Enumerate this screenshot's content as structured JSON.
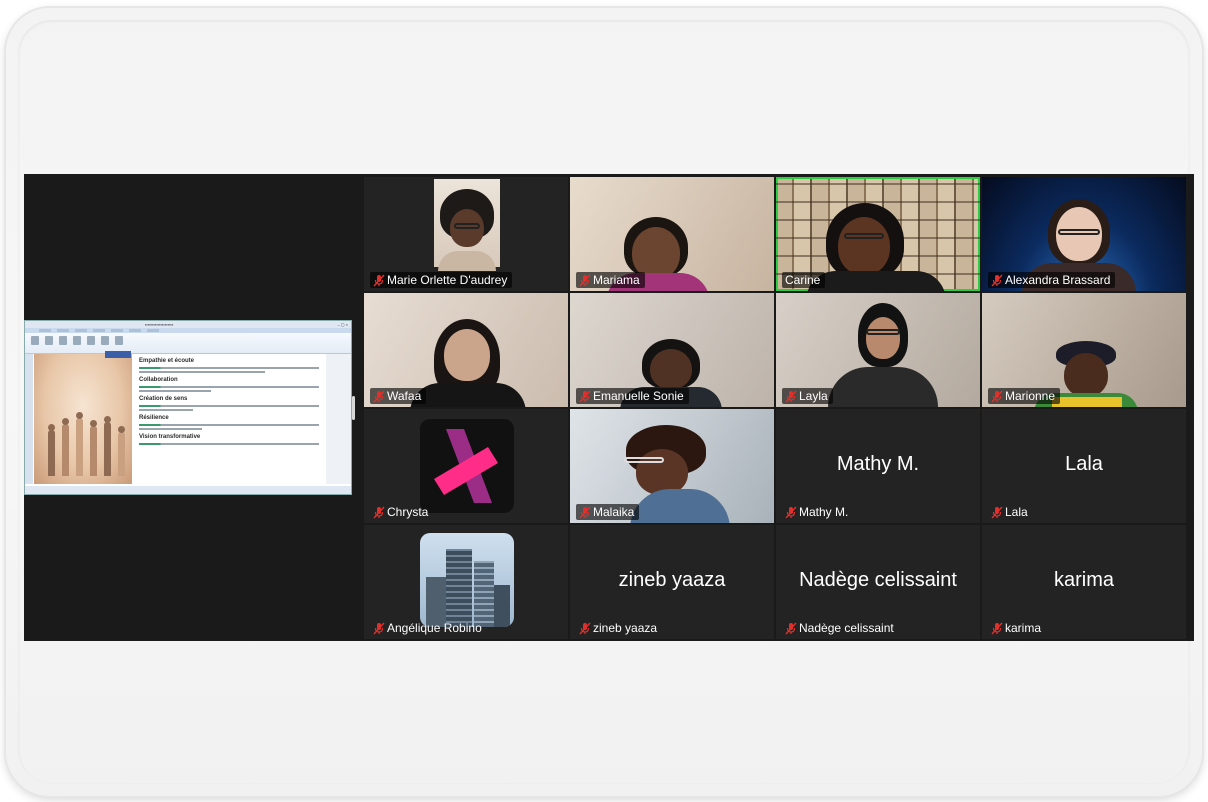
{
  "participants": [
    {
      "name": "Marie Orlette D'audrey",
      "muted": true
    },
    {
      "name": "Mariama",
      "muted": true
    },
    {
      "name": "Carine",
      "muted": false,
      "speaking": true
    },
    {
      "name": "Alexandra Brassard",
      "muted": true
    },
    {
      "name": "Wafaa",
      "muted": true
    },
    {
      "name": "Emanuelle Sonie",
      "muted": true
    },
    {
      "name": "Layla",
      "muted": true
    },
    {
      "name": "Marionne",
      "muted": true
    },
    {
      "name": "Chrysta",
      "muted": true
    },
    {
      "name": "Malaika",
      "muted": true
    },
    {
      "name": "Mathy M.",
      "muted": true,
      "video_off": true
    },
    {
      "name": "Lala",
      "muted": true,
      "video_off": true
    },
    {
      "name": "Angélique Robino",
      "muted": true
    },
    {
      "name": "zineb yaaza",
      "muted": true,
      "video_off": true
    },
    {
      "name": "Nadège celissaint",
      "muted": true,
      "video_off": true
    },
    {
      "name": "karima",
      "muted": true,
      "video_off": true
    }
  ],
  "shared_document": {
    "sections": [
      "Empathie et écoute",
      "Collaboration",
      "Création de sens",
      "Résilience",
      "Vision transformative"
    ]
  },
  "colors": {
    "speaking_border": "#2ecc40",
    "muted_icon": "#e0302b",
    "meeting_bg": "#1a1a1a",
    "tile_bg": "#232323"
  },
  "icons": {
    "muted": "mic-muted-icon"
  }
}
